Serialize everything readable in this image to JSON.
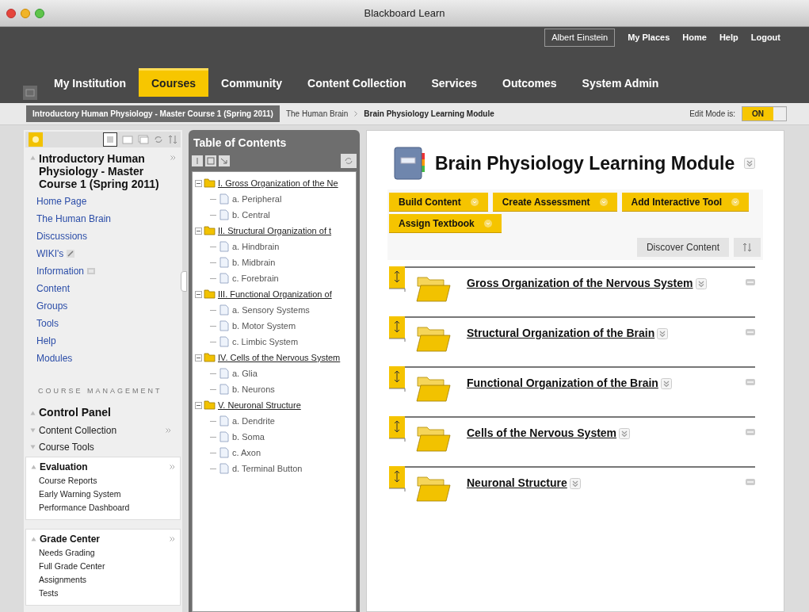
{
  "window": {
    "title": "Blackboard Learn"
  },
  "user_links": [
    {
      "label": "Albert Einstein",
      "kind": "user"
    },
    {
      "label": "My Places",
      "kind": "link"
    },
    {
      "label": "Home",
      "kind": "link"
    },
    {
      "label": "Help",
      "kind": "link"
    },
    {
      "label": "Logout",
      "kind": "link"
    }
  ],
  "tabs": [
    {
      "label": "My Institution",
      "selected": false
    },
    {
      "label": "Courses",
      "selected": true
    },
    {
      "label": "Community",
      "selected": false
    },
    {
      "label": "Content Collection",
      "selected": false
    },
    {
      "label": "Services",
      "selected": false
    },
    {
      "label": "Outcomes",
      "selected": false
    },
    {
      "label": "System Admin",
      "selected": false
    }
  ],
  "breadcrumb": {
    "course": "Introductory Human Physiology - Master Course 1 (Spring 2011)",
    "items": [
      "The Human Brain",
      "Brain Physiology Learning Module"
    ]
  },
  "edit_mode": {
    "label": "Edit Mode is:",
    "value": "ON",
    "on": true
  },
  "course_menu": {
    "title": "Introductory Human Physiology - Master Course 1 (Spring 2011)",
    "links": [
      {
        "label": "Home Page",
        "kind": "link"
      },
      {
        "label": "The Human Brain",
        "kind": "link"
      },
      {
        "label": "Discussions",
        "kind": "link"
      },
      {
        "label": "WIKI's",
        "kind": "tool"
      },
      {
        "label": "Information",
        "kind": "page"
      },
      {
        "label": "Content",
        "kind": "link"
      },
      {
        "label": "Groups",
        "kind": "link"
      },
      {
        "label": "Tools",
        "kind": "link"
      },
      {
        "label": "Help",
        "kind": "link"
      },
      {
        "label": "Modules",
        "kind": "link"
      }
    ],
    "management": {
      "heading": "COURSE MANAGEMENT",
      "title": "Control Panel",
      "sections": [
        {
          "label": "Content Collection",
          "expanded": false,
          "has_menu": true
        },
        {
          "label": "Course Tools",
          "expanded": false,
          "has_menu": false
        },
        {
          "label": "Evaluation",
          "expanded": true,
          "has_menu": true,
          "items": [
            "Course Reports",
            "Early Warning System",
            "Performance Dashboard"
          ]
        },
        {
          "label": "Grade Center",
          "expanded": true,
          "has_menu": true,
          "items": [
            "Needs Grading",
            "Full Grade Center",
            "Assignments",
            "Tests"
          ]
        }
      ]
    }
  },
  "toc": {
    "title": "Table of Contents",
    "tree": [
      {
        "label": "I. Gross Organization of the Ne",
        "expanded": true,
        "children": [
          {
            "label": "a. Peripheral"
          },
          {
            "label": "b. Central"
          }
        ]
      },
      {
        "label": "II. Structural Organization of t",
        "expanded": true,
        "children": [
          {
            "label": "a. Hindbrain"
          },
          {
            "label": "b. Midbrain"
          },
          {
            "label": "c. Forebrain"
          }
        ]
      },
      {
        "label": "III. Functional Organization of",
        "expanded": true,
        "children": [
          {
            "label": "a. Sensory Systems"
          },
          {
            "label": "b. Motor System"
          },
          {
            "label": "c. Limbic System"
          }
        ]
      },
      {
        "label": "IV. Cells of the Nervous System",
        "expanded": true,
        "children": [
          {
            "label": "a. Glia"
          },
          {
            "label": "b. Neurons"
          }
        ]
      },
      {
        "label": "V. Neuronal Structure",
        "expanded": true,
        "children": [
          {
            "label": "a. Dendrite"
          },
          {
            "label": "b. Soma"
          },
          {
            "label": "c. Axon"
          },
          {
            "label": "d. Terminal Button"
          }
        ]
      }
    ]
  },
  "content": {
    "title": "Brain Physiology Learning Module",
    "actions": [
      "Build Content",
      "Create Assessment",
      "Add Interactive Tool",
      "Assign Textbook"
    ],
    "discover": "Discover Content",
    "items": [
      {
        "title": "Gross Organization of the Nervous System"
      },
      {
        "title": "Structural Organization of the Brain"
      },
      {
        "title": "Functional Organization of the Brain"
      },
      {
        "title": "Cells of the Nervous System"
      },
      {
        "title": "Neuronal Structure"
      }
    ]
  }
}
